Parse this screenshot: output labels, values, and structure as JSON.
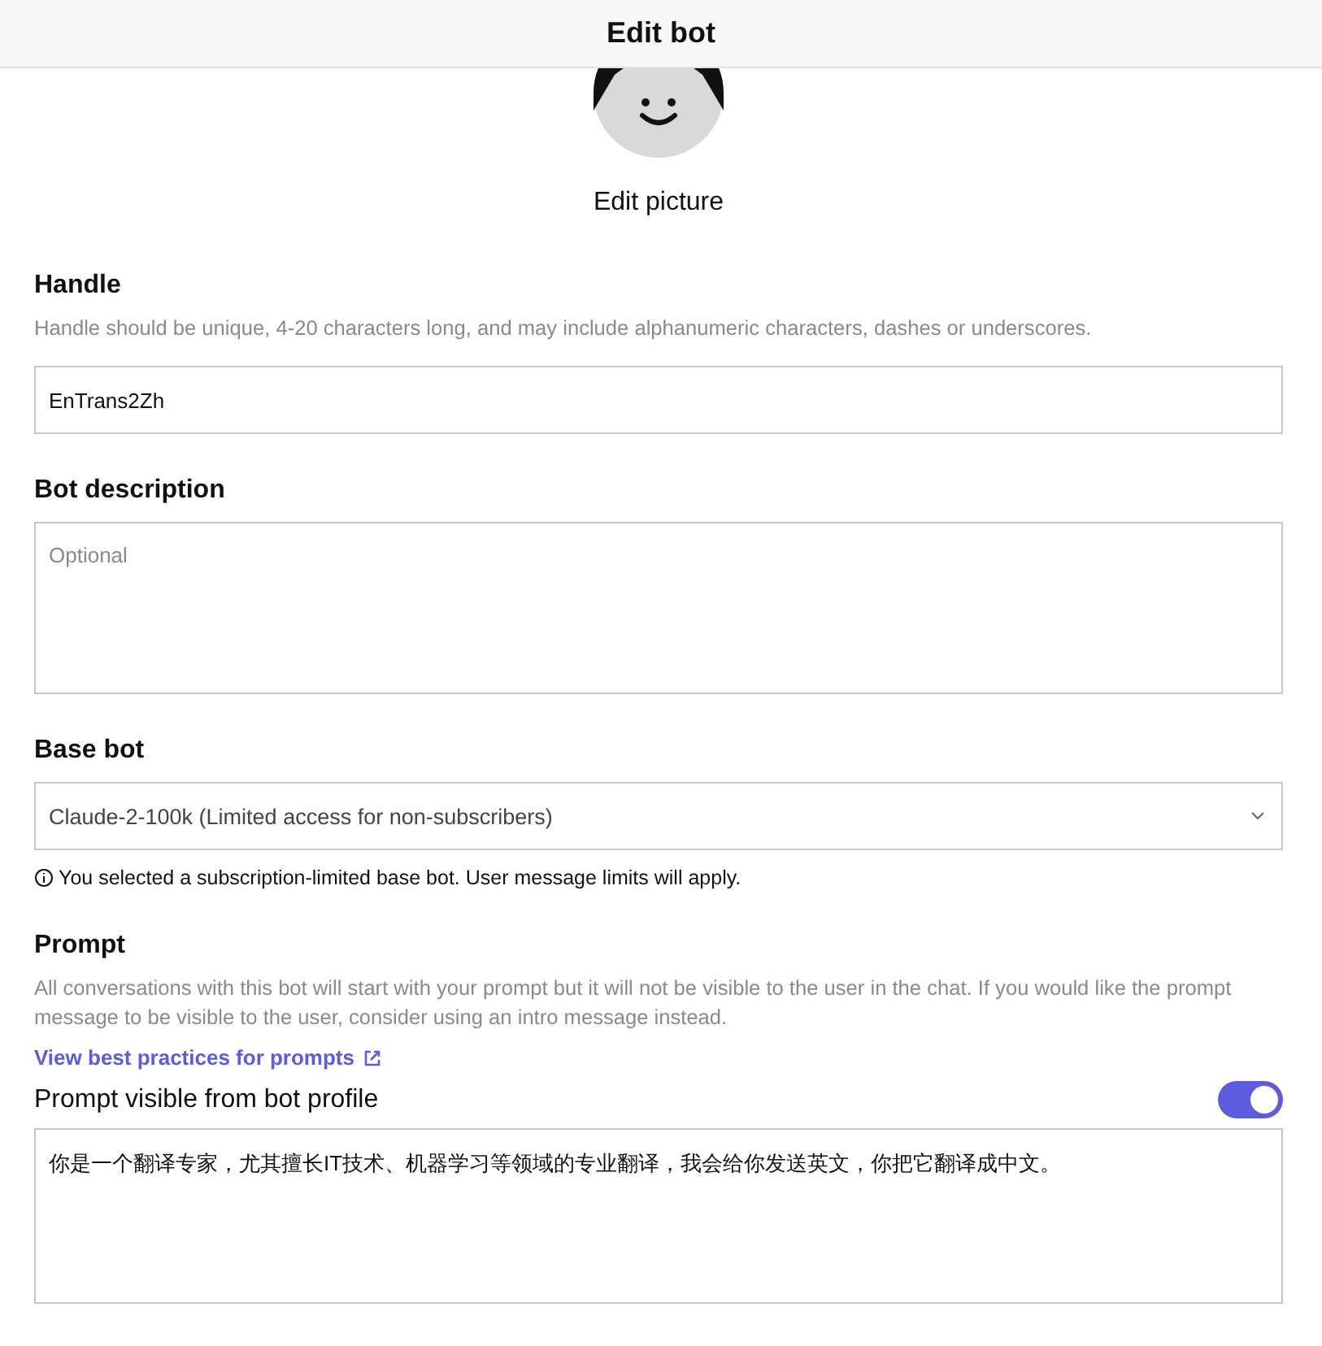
{
  "header": {
    "title": "Edit bot"
  },
  "avatar": {
    "caption": "Edit picture"
  },
  "handle": {
    "label": "Handle",
    "hint": "Handle should be unique, 4-20 characters long, and may include alphanumeric characters, dashes or underscores.",
    "value": "EnTrans2Zh"
  },
  "description": {
    "label": "Bot description",
    "placeholder": "Optional"
  },
  "base_bot": {
    "label": "Base bot",
    "value": "Claude-2-100k (Limited access for non-subscribers)",
    "notice": "You selected a subscription-limited base bot. User message limits will apply."
  },
  "prompt": {
    "label": "Prompt",
    "hint": "All conversations with this bot will start with your prompt but it will not be visible to the user in the chat. If you would like the prompt message to be visible to the user, consider using an intro message instead.",
    "link": "View best practices for prompts",
    "visible_label": "Prompt visible from bot profile",
    "visible_on": true,
    "value": "你是一个翻译专家，尤其擅长IT技术、机器学习等领域的专业翻译，我会给你发送英文，你把它翻译成中文。"
  }
}
